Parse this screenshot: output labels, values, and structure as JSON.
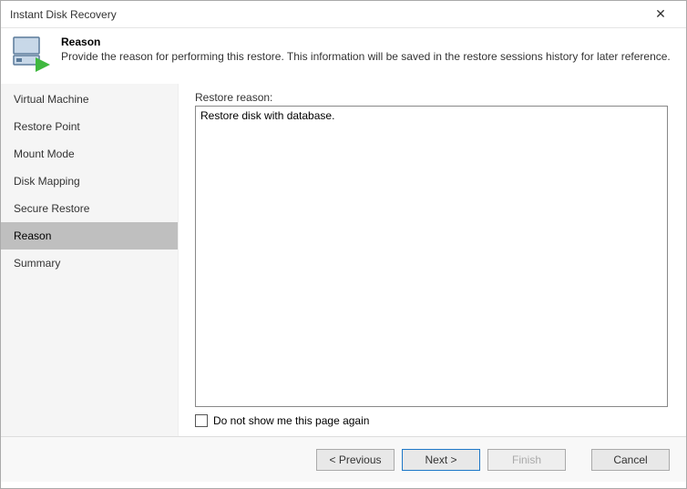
{
  "window": {
    "title": "Instant Disk Recovery"
  },
  "header": {
    "title": "Reason",
    "description": "Provide the reason for performing this restore. This information will be saved in the restore sessions history for later reference."
  },
  "sidebar": {
    "items": [
      {
        "label": "Virtual Machine"
      },
      {
        "label": "Restore Point"
      },
      {
        "label": "Mount Mode"
      },
      {
        "label": "Disk Mapping"
      },
      {
        "label": "Secure Restore"
      },
      {
        "label": "Reason"
      },
      {
        "label": "Summary"
      }
    ],
    "selected_index": 5
  },
  "main": {
    "reason_label": "Restore reason:",
    "reason_value": "Restore disk with database.",
    "checkbox_label": "Do not show me this page again",
    "checkbox_checked": false
  },
  "footer": {
    "previous": "< Previous",
    "next": "Next >",
    "finish": "Finish",
    "cancel": "Cancel"
  }
}
